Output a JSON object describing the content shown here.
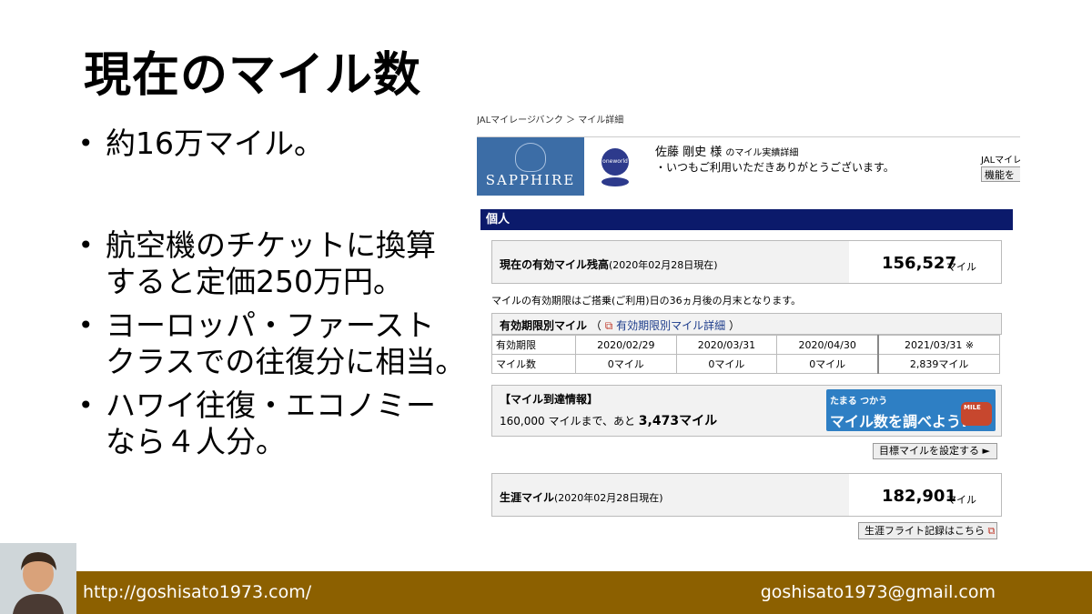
{
  "slide": {
    "title": "現在のマイル数",
    "bullets": [
      "約16万マイル。",
      "航空機のチケットに換算\nすると定価250万円。",
      "ヨーロッパ・ファースト\nクラスでの往復分に相当。",
      "ハワイ往復・エコノミー\nなら４人分。"
    ],
    "bullet_symbol": "•"
  },
  "screenshot": {
    "breadcrumb": "JALマイレージバンク ＞ マイル詳細",
    "status_brand": "SAPPHIRE",
    "alliance_logo": "oneworld",
    "member_name": "佐藤 剛史 様",
    "member_name_suffix": "のマイル実績詳細",
    "greeting": "・いつもご利用いただきありがとうございます。",
    "jal_right_label": "JALマイレ",
    "jal_right_button": "機能を",
    "section_title": "個人",
    "balance": {
      "label": "現在の有効マイル残高",
      "date": "(2020年02月28日現在)",
      "value": "156,527",
      "unit": "マイル"
    },
    "expiry_note": "マイルの有効期限はご搭乗(ご利用)日の36ヵ月後の月末となります。",
    "expiry": {
      "label": "有効期限別マイル",
      "link_open": "（",
      "link": "有効期限別マイル詳細",
      "link_close": "）",
      "row_label_date": "有効期限",
      "row_label_miles": "マイル数",
      "dates": [
        "2020/02/29",
        "2020/03/31",
        "2020/04/30",
        "2021/03/31 ※"
      ],
      "miles": [
        "0マイル",
        "0マイル",
        "0マイル",
        "2,839マイル"
      ]
    },
    "target": {
      "label": "【マイル到達情報】",
      "text_pre": "160,000 マイルまで、あと ",
      "remaining": "3,473マイル",
      "banner_small": "たまる つかう",
      "banner_big": "マイル数を調べよう!",
      "banner_badge": "MILE",
      "button": "目標マイルを設定する ►"
    },
    "lifetime": {
      "label": "生涯マイル",
      "date": "(2020年02月28日現在)",
      "value": "182,901",
      "unit": "マイル",
      "button": "生涯フライト記録はこちら"
    }
  },
  "footer": {
    "url": "http://goshisato1973.com/",
    "email": "goshisato1973@gmail.com"
  },
  "colors": {
    "footer_bg": "#8c6000",
    "section_header_bg": "#0b1a6b",
    "sapphire_bg": "#3c6da6"
  }
}
